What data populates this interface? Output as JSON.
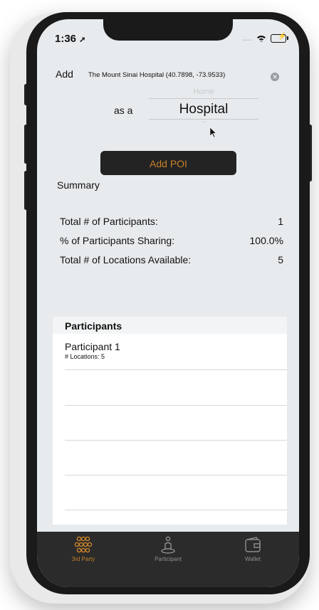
{
  "status": {
    "time": "1:36",
    "dots": "....",
    "wifi": "wifi-icon",
    "battery": "battery-charging-icon"
  },
  "add_form": {
    "add_label": "Add",
    "place": "The Mount Sinai Hospital (40.7898, -73.9533)",
    "as_a_label": "as a",
    "picker_ghost_above": "Home",
    "picker_ghost_below": "~",
    "picker_value": "Hospital",
    "button_label": "Add POI"
  },
  "summary": {
    "title": "Summary",
    "stats": [
      {
        "label": "Total # of Participants:",
        "value": "1"
      },
      {
        "label": "% of Participants Sharing:",
        "value": "100.0%"
      },
      {
        "label": "Total # of Locations Available:",
        "value": "5"
      }
    ]
  },
  "participants": {
    "header": "Participants",
    "items": [
      {
        "name": "Participant 1",
        "detail": "# Locations: 5"
      }
    ]
  },
  "tabbar": {
    "tabs": [
      {
        "label": "3rd Party",
        "icon": "group-icon",
        "active": true
      },
      {
        "label": "Participant",
        "icon": "participant-icon",
        "active": false
      },
      {
        "label": "Wallet",
        "icon": "wallet-icon",
        "active": false
      }
    ]
  },
  "colors": {
    "accent": "#c8822b",
    "inactive": "#8e8e8e",
    "button_bg": "#232323"
  }
}
